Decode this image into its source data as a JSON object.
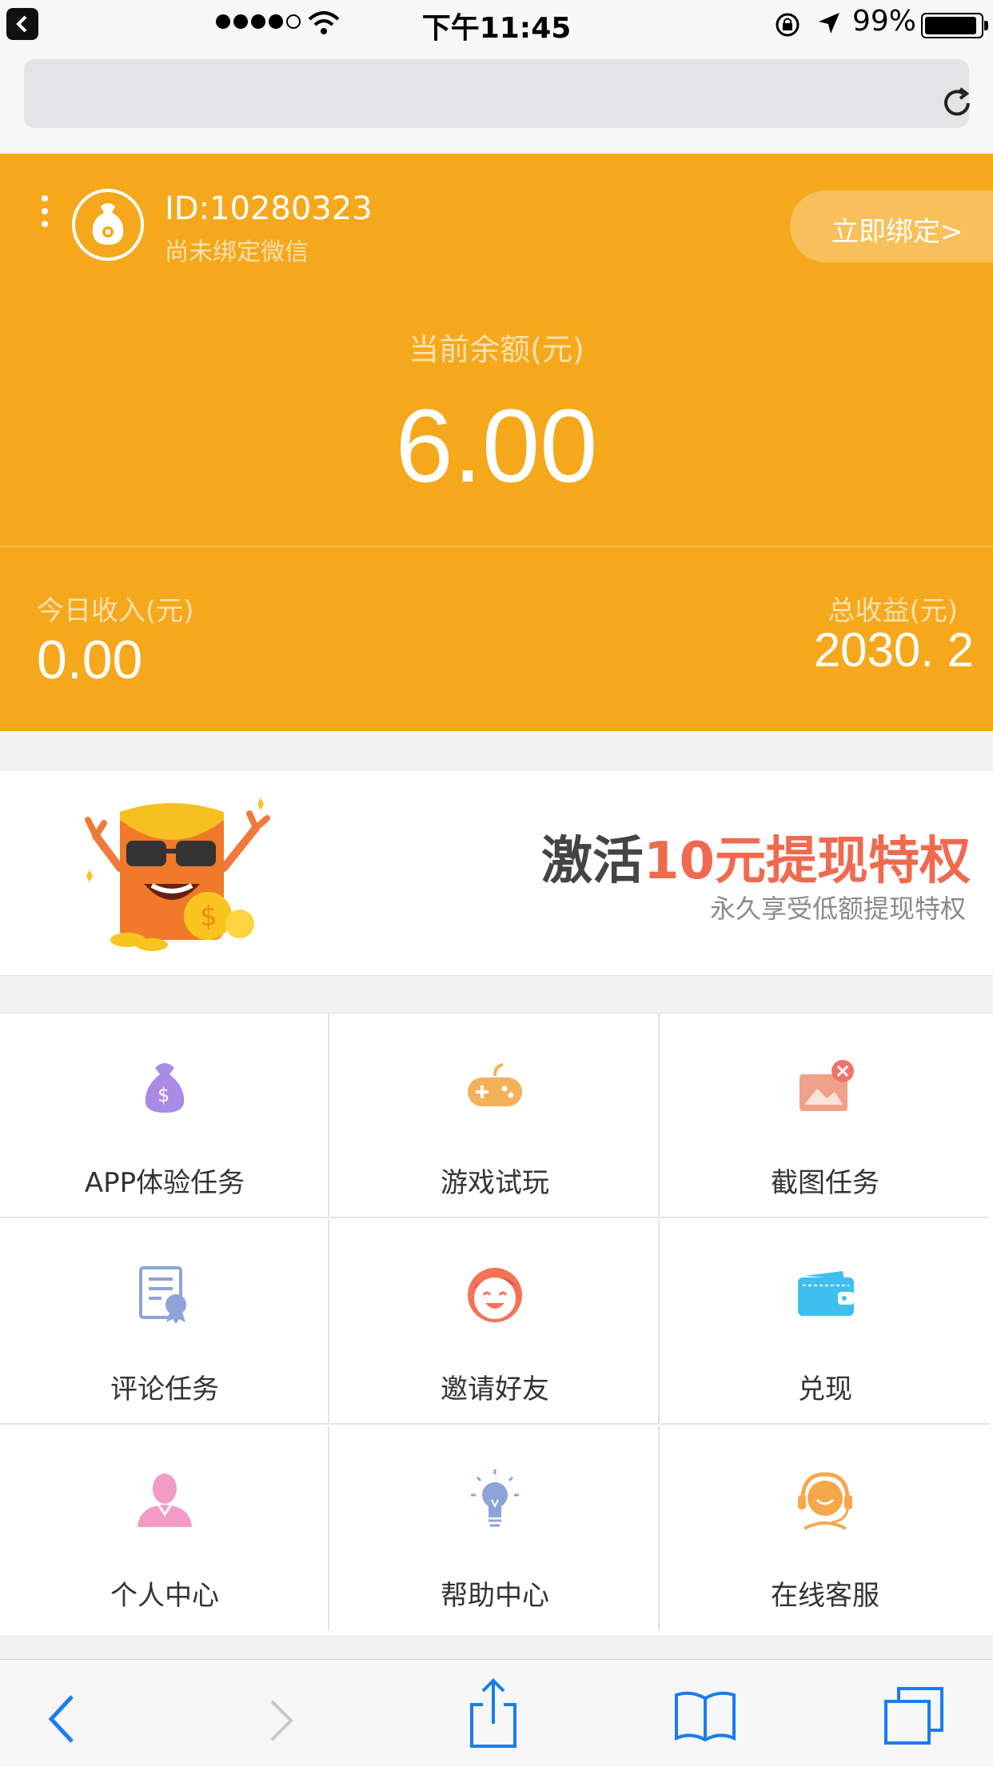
{
  "status_bar": {
    "time": "下午11:45",
    "battery": "99%"
  },
  "header": {
    "user_id": "ID:10280323",
    "wechat_status": "尚未绑定微信",
    "bind_button": "立即绑定>",
    "balance_label": "当前余额(元)",
    "balance_value": "6.00",
    "today_income_label": "今日收入(元)",
    "today_income_value": "0.00",
    "total_income_label": "总收益(元)",
    "total_income_value": "2030. 2"
  },
  "banner": {
    "title_prefix": "激活",
    "title_highlight": "10元提现特权",
    "subtitle": "永久享受低额提现特权"
  },
  "menu": {
    "items": [
      {
        "label": "APP体验任务",
        "icon": "money-bag-icon",
        "color": "#a98be6"
      },
      {
        "label": "游戏试玩",
        "icon": "gamepad-icon",
        "color": "#f5b05a"
      },
      {
        "label": "截图任务",
        "icon": "image-scissors-icon",
        "color": "#f0a189"
      },
      {
        "label": "评论任务",
        "icon": "certificate-icon",
        "color": "#8ea3d8"
      },
      {
        "label": "邀请好友",
        "icon": "smiley-face-icon",
        "color": "#f47257"
      },
      {
        "label": "兑现",
        "icon": "wallet-icon",
        "color": "#3fbff0"
      },
      {
        "label": "个人中心",
        "icon": "person-icon",
        "color": "#f39bc7"
      },
      {
        "label": "帮助中心",
        "icon": "lightbulb-icon",
        "color": "#8ea3d8"
      },
      {
        "label": "在线客服",
        "icon": "headset-icon",
        "color": "#f5a84a"
      }
    ]
  },
  "colors": {
    "header_bg": "#f5a81c",
    "accent_red": "#f06a50",
    "ios_blue": "#1a7cf2"
  }
}
